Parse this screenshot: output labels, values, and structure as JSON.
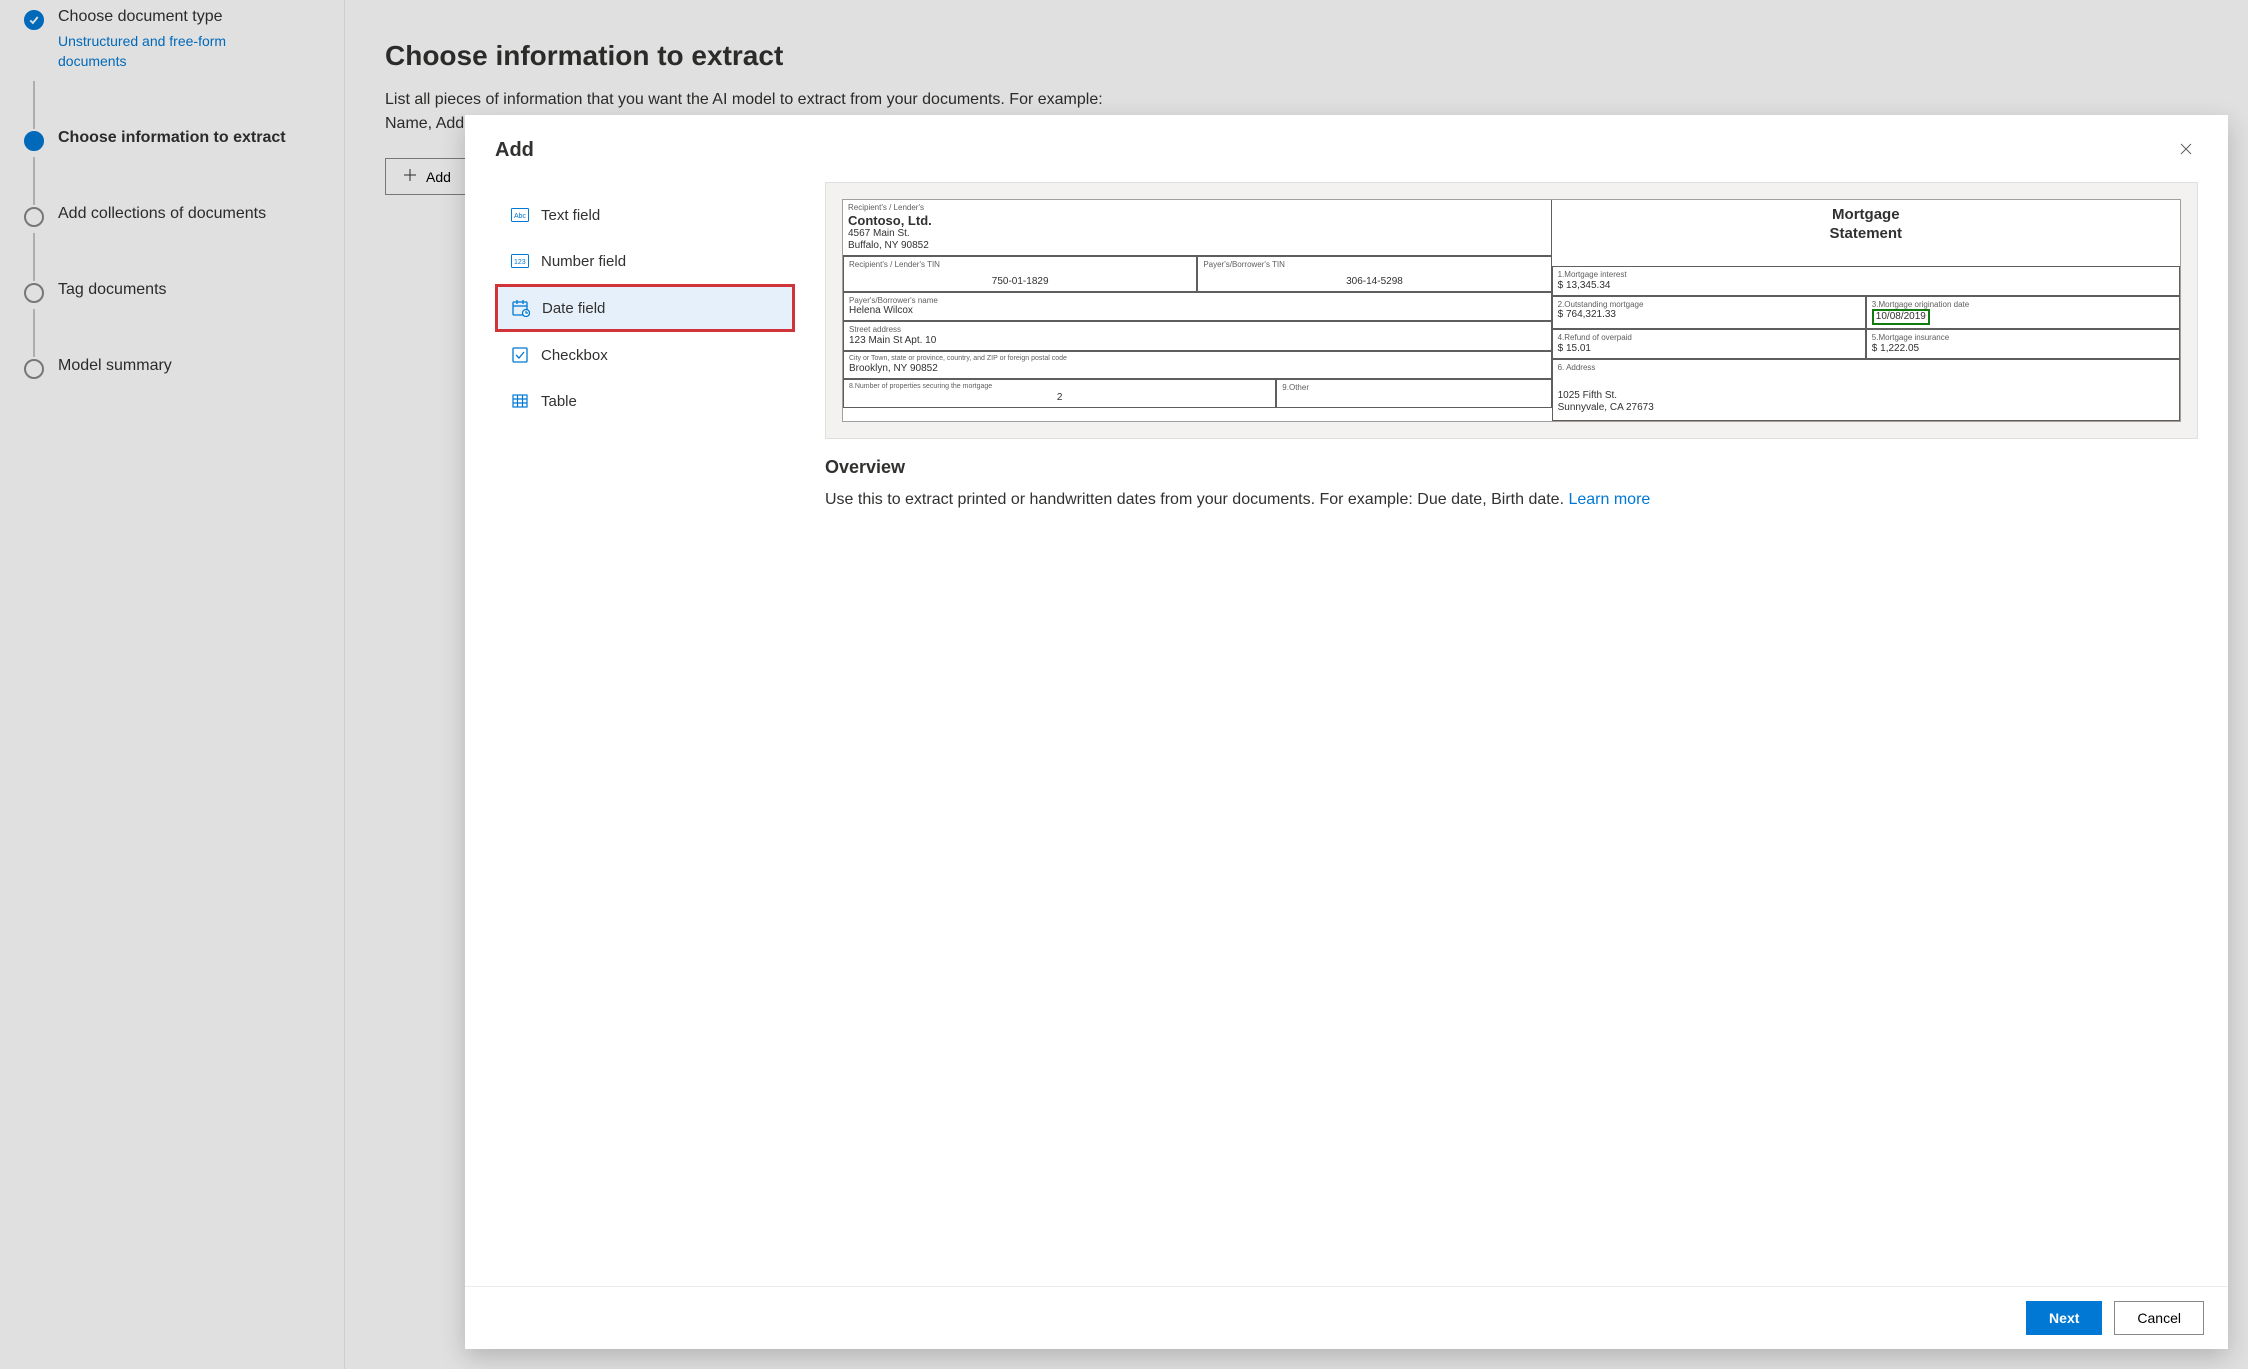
{
  "steps": {
    "s1": {
      "title": "Choose document type",
      "sub": "Unstructured and free-form documents"
    },
    "s2": {
      "title": "Choose information to extract"
    },
    "s3": {
      "title": "Add collections of documents"
    },
    "s4": {
      "title": "Tag documents"
    },
    "s5": {
      "title": "Model summary"
    }
  },
  "page": {
    "title": "Choose information to extract",
    "desc": "List all pieces of information that you want the AI model to extract from your documents. For example: Name, Address, Total amount, Line items… You'll tag them in the documents.",
    "add_label": "Add"
  },
  "modal": {
    "title": "Add",
    "fields": {
      "text": "Text field",
      "number": "Number field",
      "date": "Date field",
      "checkbox": "Checkbox",
      "table": "Table"
    },
    "overview_title": "Overview",
    "overview_text": "Use this to extract printed or handwritten dates from your documents. For example: Due date, Birth date. ",
    "learn_more": "Learn more",
    "next_label": "Next",
    "cancel_label": "Cancel"
  },
  "preview": {
    "recip_label": "Recipient's / Lender's",
    "company": "Contoso, Ltd.",
    "addr1": "4567 Main St.",
    "addr2": "Buffalo, NY 90852",
    "right_title1": "Mortgage",
    "right_title2": "Statement",
    "r1l": "Recipient's / Lender's TIN",
    "r1l_v": "750-01-1829",
    "r1r": "Payer's/Borrower's TIN",
    "r1r_v": "306-14-5298",
    "c1l": "1.Mortgage interest",
    "c1v": "$  13,345.34",
    "c2l": "2.Outstanding mortgage",
    "c2v": "$  764,321.33",
    "c3l": "3.Mortgage origination date",
    "c3v": "10/08/2019",
    "c4l": "4.Refund of overpaid",
    "c4v": "$  15.01",
    "c5l": "5.Mortgage insurance",
    "c5v": "$  1,222.05",
    "c6l": "6. Address",
    "borrower_l": "Payer's/Borrower's name",
    "borrower_v": "Helena Wilcox",
    "street_l": "Street address",
    "street_v": "123 Main St Apt. 10",
    "city_l": "City or Town, state or province, country, and ZIP or foreign postal code",
    "city_v": "Brooklyn, NY 90852",
    "props_l": "8.Number of properties securing the mortgage",
    "props_v": "2",
    "other_l": "9.Other",
    "raddr1": "1025 Fifth St.",
    "raddr2": "Sunnyvale, CA 27673"
  }
}
